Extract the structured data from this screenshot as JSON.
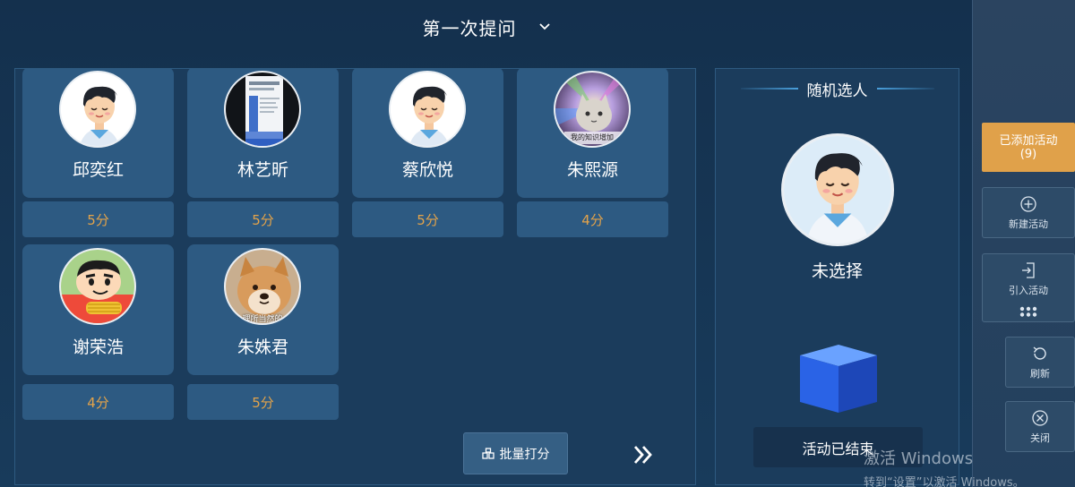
{
  "header": {
    "title": "第一次提问"
  },
  "students": [
    {
      "name": "邱奕红",
      "score": "5分",
      "avatar": "cartoon-boy"
    },
    {
      "name": "林艺昕",
      "score": "5分",
      "avatar": "document-photo"
    },
    {
      "name": "蔡欣悦",
      "score": "5分",
      "avatar": "cartoon-boy"
    },
    {
      "name": "朱熙源",
      "score": "4分",
      "avatar": "cat-meme",
      "avatar_caption": "我的知识增加"
    },
    {
      "name": "谢荣浩",
      "score": "4分",
      "avatar": "crayon-shinchan"
    },
    {
      "name": "朱姝君",
      "score": "5分",
      "avatar": "shiba-dog",
      "avatar_caption": "理所当然的"
    }
  ],
  "toolbar": {
    "batch_score_label": "批量打分"
  },
  "random": {
    "title": "随机选人",
    "status": "未选择",
    "activity_status": "活动已结束"
  },
  "sidebar": {
    "added_activity_label": "已添加活动",
    "added_activity_count": "(9)",
    "new_activity_label": "新建活动",
    "import_activity_label": "引入活动",
    "refresh_label": "刷新",
    "close_label": "关闭"
  },
  "watermark": {
    "line1": "激活 Windows",
    "line2": "转到“设置”以激活 Windows。"
  },
  "colors": {
    "accent_orange": "#e0a14a",
    "score_text": "#e3a34a",
    "card_bg": "#2d5a82",
    "panel_bg": "#1b3c5c"
  }
}
